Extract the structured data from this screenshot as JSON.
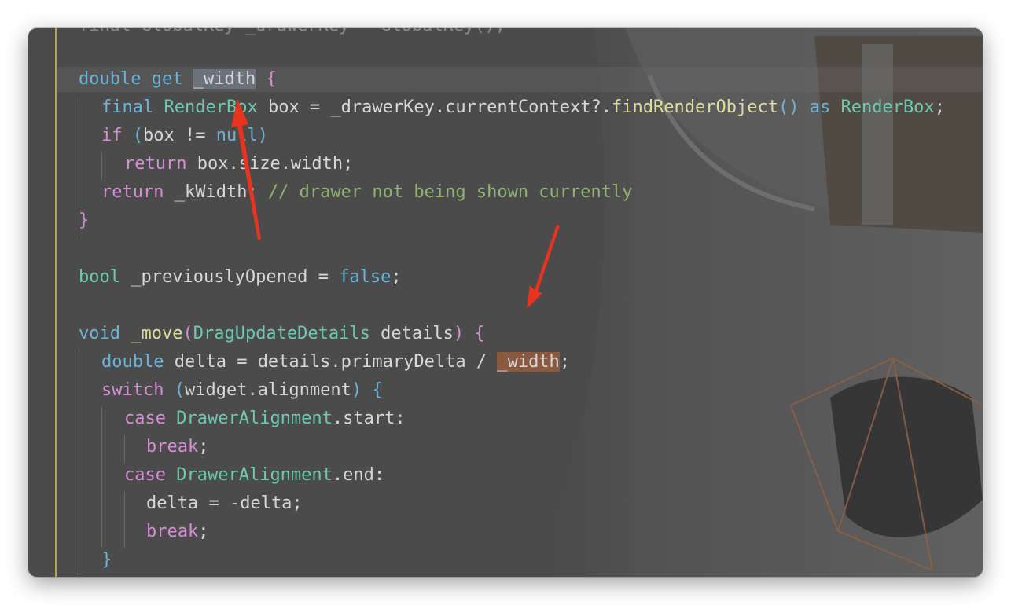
{
  "editor": {
    "lines": [
      {
        "text_parts": [
          {
            "t": "final GlobalKey _drawerKey = GlobalKey();",
            "c": "var"
          }
        ]
      },
      {
        "text_parts": []
      },
      {
        "text_parts": [
          {
            "t": "double",
            "c": "kw"
          },
          {
            "t": " ",
            "c": "var"
          },
          {
            "t": "get",
            "c": "kw"
          },
          {
            "t": " ",
            "c": "var"
          },
          {
            "t": "_width",
            "c": "var sel-grey"
          },
          {
            "t": " ",
            "c": "var"
          },
          {
            "t": "{",
            "c": "br1"
          }
        ]
      },
      {
        "text_parts": [
          {
            "t": "final",
            "c": "kw"
          },
          {
            "t": " ",
            "c": "var"
          },
          {
            "t": "RenderBox",
            "c": "type"
          },
          {
            "t": " box = _drawerKey.currentContext?.",
            "c": "var"
          },
          {
            "t": "findRenderObject",
            "c": "fn"
          },
          {
            "t": "()",
            "c": "br2"
          },
          {
            "t": " ",
            "c": "var"
          },
          {
            "t": "as",
            "c": "kw"
          },
          {
            "t": " ",
            "c": "var"
          },
          {
            "t": "RenderBox",
            "c": "type"
          },
          {
            "t": ";",
            "c": "var"
          }
        ]
      },
      {
        "text_parts": [
          {
            "t": "if",
            "c": "kw2"
          },
          {
            "t": " ",
            "c": "var"
          },
          {
            "t": "(",
            "c": "br2"
          },
          {
            "t": "box != ",
            "c": "var"
          },
          {
            "t": "null",
            "c": "kw"
          },
          {
            "t": ")",
            "c": "br2"
          }
        ]
      },
      {
        "text_parts": [
          {
            "t": "return",
            "c": "kw2"
          },
          {
            "t": " box.size.width;",
            "c": "var"
          }
        ]
      },
      {
        "text_parts": [
          {
            "t": "return",
            "c": "kw2"
          },
          {
            "t": " _kWidth; ",
            "c": "var"
          },
          {
            "t": "// drawer not being shown currently",
            "c": "cmt"
          }
        ]
      },
      {
        "text_parts": [
          {
            "t": "}",
            "c": "br1"
          }
        ]
      },
      {
        "text_parts": []
      },
      {
        "text_parts": [
          {
            "t": "bool",
            "c": "type"
          },
          {
            "t": " _previouslyOpened = ",
            "c": "var"
          },
          {
            "t": "false",
            "c": "kw"
          },
          {
            "t": ";",
            "c": "var"
          }
        ]
      },
      {
        "text_parts": []
      },
      {
        "text_parts": [
          {
            "t": "void",
            "c": "kw"
          },
          {
            "t": " ",
            "c": "var"
          },
          {
            "t": "_move",
            "c": "fn"
          },
          {
            "t": "(",
            "c": "br1"
          },
          {
            "t": "DragUpdateDetails",
            "c": "type"
          },
          {
            "t": " details",
            "c": "var"
          },
          {
            "t": ")",
            "c": "br1"
          },
          {
            "t": " ",
            "c": "var"
          },
          {
            "t": "{",
            "c": "br1"
          }
        ]
      },
      {
        "text_parts": [
          {
            "t": "double",
            "c": "kw"
          },
          {
            "t": " delta = details.primaryDelta / ",
            "c": "var"
          },
          {
            "t": "_width",
            "c": "var sel-orange"
          },
          {
            "t": ";",
            "c": "var"
          }
        ]
      },
      {
        "text_parts": [
          {
            "t": "switch",
            "c": "kw2"
          },
          {
            "t": " ",
            "c": "var"
          },
          {
            "t": "(",
            "c": "br2"
          },
          {
            "t": "widget.alignment",
            "c": "var"
          },
          {
            "t": ")",
            "c": "br2"
          },
          {
            "t": " ",
            "c": "var"
          },
          {
            "t": "{",
            "c": "br2"
          }
        ]
      },
      {
        "text_parts": [
          {
            "t": "case",
            "c": "kw2"
          },
          {
            "t": " ",
            "c": "var"
          },
          {
            "t": "DrawerAlignment",
            "c": "type"
          },
          {
            "t": ".start:",
            "c": "var"
          }
        ]
      },
      {
        "text_parts": [
          {
            "t": "break",
            "c": "kw2"
          },
          {
            "t": ";",
            "c": "var"
          }
        ]
      },
      {
        "text_parts": [
          {
            "t": "case",
            "c": "kw2"
          },
          {
            "t": " ",
            "c": "var"
          },
          {
            "t": "DrawerAlignment",
            "c": "type"
          },
          {
            "t": ".end:",
            "c": "var"
          }
        ]
      },
      {
        "text_parts": [
          {
            "t": "delta = -delta;",
            "c": "var"
          }
        ]
      },
      {
        "text_parts": [
          {
            "t": "break",
            "c": "kw2"
          },
          {
            "t": ";",
            "c": "var"
          }
        ]
      },
      {
        "text_parts": [
          {
            "t": "}",
            "c": "br2"
          }
        ]
      }
    ]
  },
  "colors": {
    "editor_bg": "#4b4b4b",
    "gutter_marker": "#b4a350",
    "keyword": "#6db3d8",
    "control": "#d58fd4",
    "type": "#6dc9b0",
    "function": "#dcdc9f",
    "comment": "#93b377",
    "selection_grey": "#6b727c",
    "selection_orange": "#8a5a40",
    "annotation_arrow": "#e8331e"
  },
  "icons": [
    "annotation-arrow-icon"
  ]
}
